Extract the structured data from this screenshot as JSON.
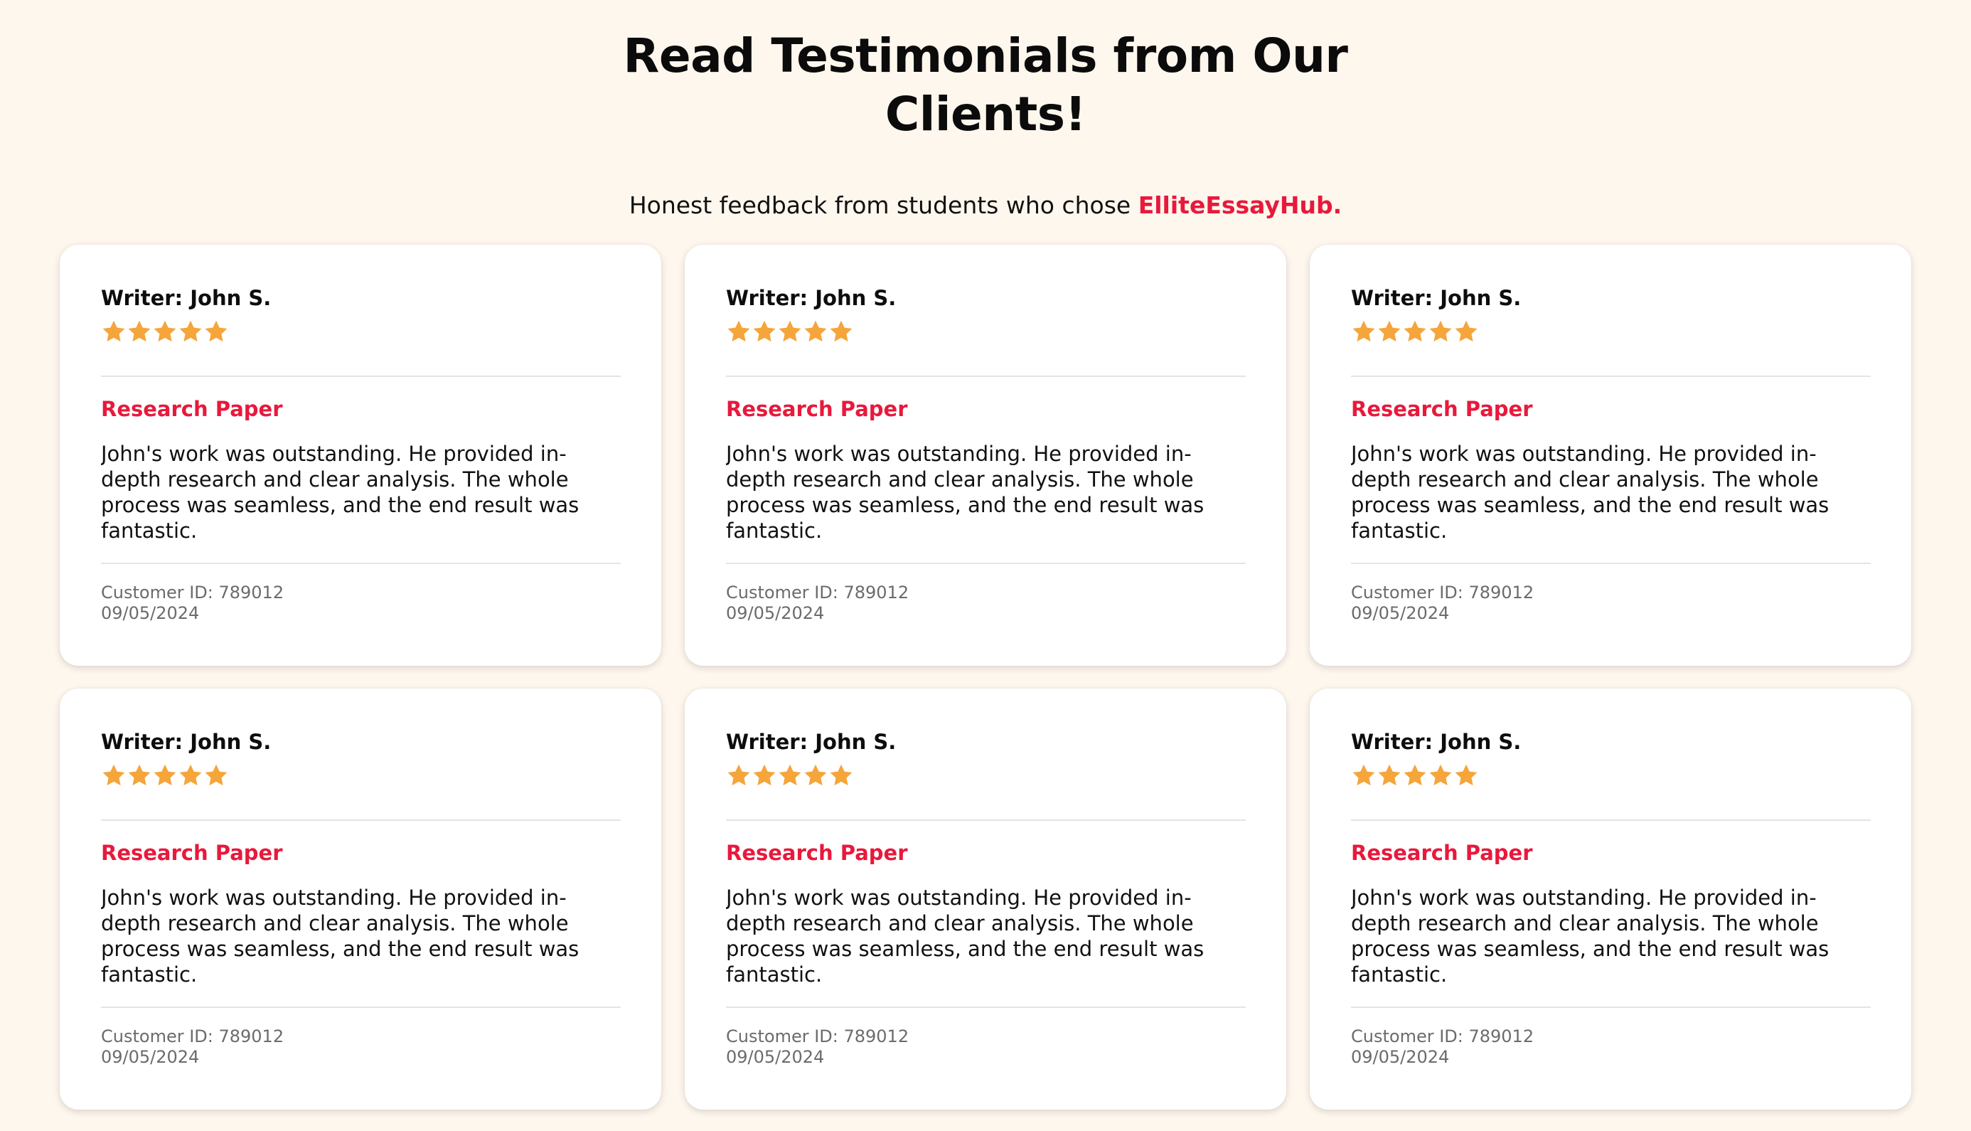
{
  "header": {
    "title_line1": "Read Testimonials from Our",
    "title_line2": "Clients!",
    "subtitle_prefix": "Honest feedback from students who chose ",
    "brand": "ElliteEssayHub."
  },
  "colors": {
    "background": "#fef7ee",
    "accent": "#e8193c",
    "star": "#f5a53a",
    "card": "#ffffff"
  },
  "star_icon": "star-icon",
  "testimonials": [
    {
      "writer": "Writer: John S.",
      "rating": 5,
      "category": "Research Paper",
      "text": "John's work was outstanding. He provided in-depth research and clear analysis. The whole process was seamless, and the end result was fantastic.",
      "customer_id": "Customer ID: 789012",
      "date": "09/05/2024"
    },
    {
      "writer": "Writer: John S.",
      "rating": 5,
      "category": "Research Paper",
      "text": "John's work was outstanding. He provided in-depth research and clear analysis. The whole process was seamless, and the end result was fantastic.",
      "customer_id": "Customer ID: 789012",
      "date": "09/05/2024"
    },
    {
      "writer": "Writer: John S.",
      "rating": 5,
      "category": "Research Paper",
      "text": "John's work was outstanding. He provided in-depth research and clear analysis. The whole process was seamless, and the end result was fantastic.",
      "customer_id": "Customer ID: 789012",
      "date": "09/05/2024"
    },
    {
      "writer": "Writer: John S.",
      "rating": 5,
      "category": "Research Paper",
      "text": "John's work was outstanding. He provided in-depth research and clear analysis. The whole process was seamless, and the end result was fantastic.",
      "customer_id": "Customer ID: 789012",
      "date": "09/05/2024"
    },
    {
      "writer": "Writer: John S.",
      "rating": 5,
      "category": "Research Paper",
      "text": "John's work was outstanding. He provided in-depth research and clear analysis. The whole process was seamless, and the end result was fantastic.",
      "customer_id": "Customer ID: 789012",
      "date": "09/05/2024"
    },
    {
      "writer": "Writer: John S.",
      "rating": 5,
      "category": "Research Paper",
      "text": "John's work was outstanding. He provided in-depth research and clear analysis. The whole process was seamless, and the end result was fantastic.",
      "customer_id": "Customer ID: 789012",
      "date": "09/05/2024"
    }
  ]
}
